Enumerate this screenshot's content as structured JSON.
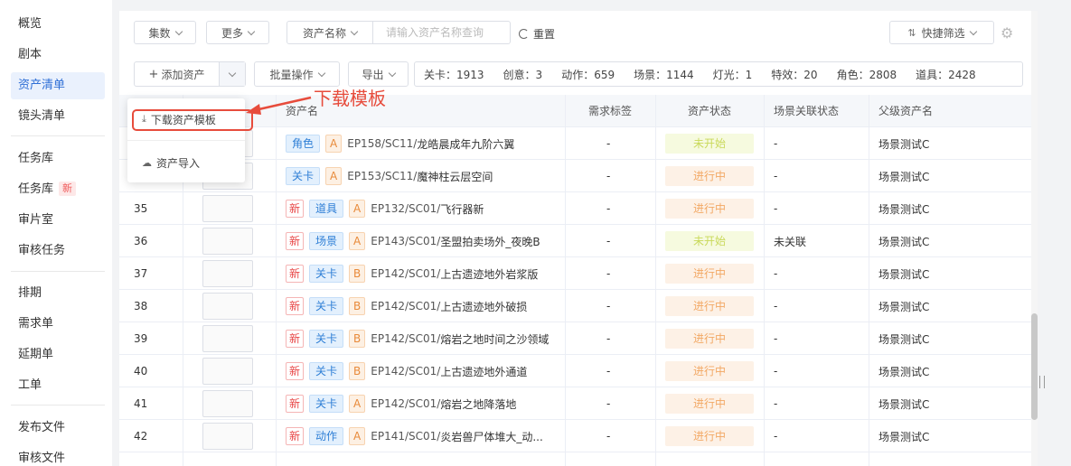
{
  "sidebar": {
    "items": [
      {
        "label": "概览"
      },
      {
        "label": "剧本"
      },
      {
        "label": "资产清单",
        "active": true
      },
      {
        "label": "镜头清单"
      },
      {
        "label": "任务库"
      },
      {
        "label": "任务库",
        "badge": "新"
      },
      {
        "label": "审片室"
      },
      {
        "label": "审核任务"
      },
      {
        "label": "排期"
      },
      {
        "label": "需求单"
      },
      {
        "label": "延期单"
      },
      {
        "label": "工单"
      },
      {
        "label": "发布文件"
      },
      {
        "label": "审核文件"
      }
    ]
  },
  "toolbar": {
    "ji_shu": "集数",
    "more": "更多",
    "asset_name_select": "资产名称",
    "search_placeholder": "请输入资产名称查询",
    "reset": "重置",
    "quick_filter": "快捷筛选",
    "add_asset": "添加资产",
    "batch": "批量操作",
    "export": "导出"
  },
  "stats": [
    "关卡：1913",
    "创意：3",
    "动作：659",
    "场景：1144",
    "灯光：1",
    "特效：20",
    "角色：2808",
    "道具：2428"
  ],
  "table": {
    "headers": {
      "name": "资产名",
      "demand_tag": "需求标签",
      "status": "资产状态",
      "scene_link": "场景关联状态",
      "parent": "父级资产名"
    },
    "rows": [
      {
        "num": "",
        "new": "",
        "type": "角色",
        "level": "A",
        "code": "EP158/SC11/",
        "title": "龙皓晨成年九阶六翼",
        "demand": "-",
        "status": "未开始",
        "scene": "-",
        "parent": "场景测试C"
      },
      {
        "num": "",
        "new": "",
        "type": "关卡",
        "level": "A",
        "code": "EP153/SC11/",
        "title": "魔神柱云层空间",
        "demand": "-",
        "status": "进行中",
        "scene": "-",
        "parent": "场景测试C"
      },
      {
        "num": "35",
        "new": "新",
        "type": "道具",
        "level": "A",
        "code": "EP132/SC01/",
        "title": "飞行器新",
        "demand": "-",
        "status": "进行中",
        "scene": "-",
        "parent": "场景测试C"
      },
      {
        "num": "36",
        "new": "新",
        "type": "场景",
        "level": "A",
        "code": "EP143/SC01/",
        "title": "圣盟拍卖场外_夜晚B",
        "demand": "-",
        "status": "未开始",
        "scene": "未关联",
        "parent": "场景测试C"
      },
      {
        "num": "37",
        "new": "新",
        "type": "关卡",
        "level": "B",
        "code": "EP142/SC01/",
        "title": "上古遗迹地外岩浆版",
        "demand": "-",
        "status": "进行中",
        "scene": "-",
        "parent": "场景测试C"
      },
      {
        "num": "38",
        "new": "新",
        "type": "关卡",
        "level": "B",
        "code": "EP142/SC01/",
        "title": "上古遗迹地外破损",
        "demand": "-",
        "status": "进行中",
        "scene": "-",
        "parent": "场景测试C"
      },
      {
        "num": "39",
        "new": "新",
        "type": "关卡",
        "level": "B",
        "code": "EP142/SC01/",
        "title": "熔岩之地时间之沙领域",
        "demand": "-",
        "status": "进行中",
        "scene": "-",
        "parent": "场景测试C"
      },
      {
        "num": "40",
        "new": "新",
        "type": "关卡",
        "level": "B",
        "code": "EP142/SC01/",
        "title": "上古遗迹地外通道",
        "demand": "-",
        "status": "进行中",
        "scene": "-",
        "parent": "场景测试C"
      },
      {
        "num": "41",
        "new": "新",
        "type": "关卡",
        "level": "A",
        "code": "EP142/SC01/",
        "title": "熔岩之地降落地",
        "demand": "-",
        "status": "进行中",
        "scene": "-",
        "parent": "场景测试C"
      },
      {
        "num": "42",
        "new": "新",
        "type": "动作",
        "level": "A",
        "code": "EP141/SC01/",
        "title": "炎岩兽尸体堆大_动...",
        "demand": "-",
        "status": "进行中",
        "scene": "-",
        "parent": "场景测试C"
      }
    ]
  },
  "dropdown": {
    "download_template": "下载资产模板",
    "import": "资产导入"
  },
  "annotation": "下载模板"
}
